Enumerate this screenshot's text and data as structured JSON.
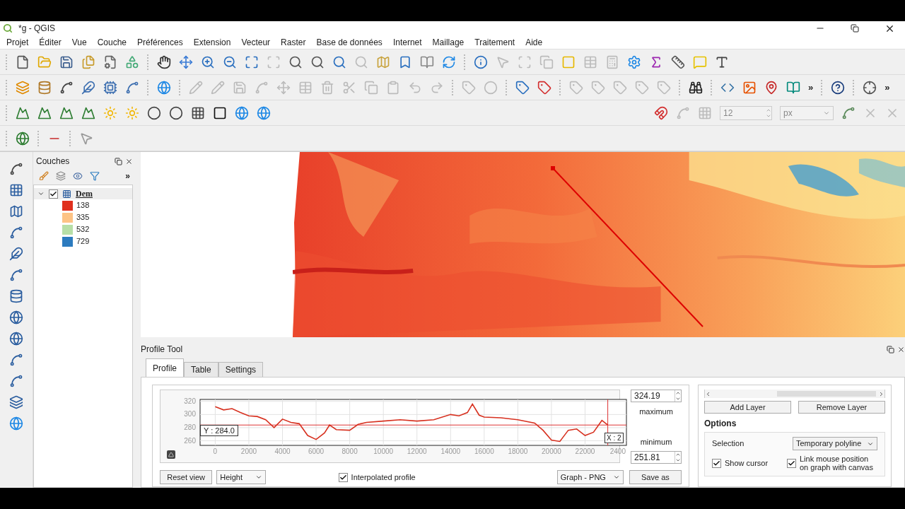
{
  "window": {
    "title": "*g - QGIS"
  },
  "menu": [
    "Projet",
    "Éditer",
    "Vue",
    "Couche",
    "Préférences",
    "Extension",
    "Vecteur",
    "Raster",
    "Base de données",
    "Internet",
    "Maillage",
    "Traitement",
    "Aide"
  ],
  "toolbar": {
    "overflow": [
      "»",
      "»"
    ],
    "snapping_tolerance": "12",
    "snapping_unit": "px"
  },
  "layers_panel": {
    "title": "Couches",
    "overflow": "»",
    "layers": [
      {
        "name": "Dem",
        "checked": true,
        "expanded": true,
        "children": [
          {
            "label": "138",
            "color": "#e0301e"
          },
          {
            "label": "335",
            "color": "#fdc385"
          },
          {
            "label": "532",
            "color": "#b7dfa7"
          },
          {
            "label": "729",
            "color": "#2c7bbf"
          }
        ]
      }
    ]
  },
  "profile_tool": {
    "title": "Profile Tool",
    "tabs": [
      {
        "label": "Profile",
        "selected": true
      },
      {
        "label": "Table",
        "selected": false
      },
      {
        "label": "Settings",
        "selected": false
      }
    ],
    "chart_data": {
      "type": "line",
      "x": [
        0,
        500,
        1000,
        1500,
        2000,
        2500,
        3000,
        3500,
        4000,
        4500,
        5000,
        5500,
        6000,
        6500,
        6800,
        7200,
        8000,
        8500,
        9000,
        10000,
        11000,
        12000,
        13000,
        14000,
        14500,
        15000,
        15300,
        15700,
        16000,
        17000,
        18000,
        19000,
        19500,
        20000,
        20500,
        21000,
        21500,
        22000,
        22500,
        23000,
        23350
      ],
      "series": [
        {
          "color": "#d7301f",
          "values": [
            312,
            307,
            309,
            303,
            298,
            297,
            292,
            280,
            293,
            288,
            286,
            268,
            262,
            272,
            284,
            277,
            276,
            285,
            288,
            290,
            292,
            290,
            292,
            300,
            298,
            303,
            316,
            299,
            296,
            295,
            292,
            287,
            276,
            261,
            259,
            276,
            278,
            268,
            273,
            291,
            284
          ]
        }
      ],
      "xlim": [
        -900,
        24460
      ],
      "ylim": [
        253,
        323
      ],
      "xticks": [
        0,
        2000,
        4000,
        6000,
        8000,
        10000,
        12000,
        14000,
        16000,
        18000,
        20000,
        22000
      ],
      "yticks": [
        260,
        280,
        300,
        320
      ],
      "grid": true,
      "ref_lines": [
        {
          "axis": "y",
          "value": 284
        },
        {
          "axis": "x",
          "value": 23350
        }
      ]
    },
    "x_tick_cut": "2400",
    "cursor_y": "Y : 284.0",
    "cursor_x": "X : 2",
    "maximum": {
      "value": "324.19",
      "label": "maximum"
    },
    "minimum": {
      "value": "251.81",
      "label": "minimum"
    },
    "reset_button": "Reset view",
    "plot_select": "Height",
    "interpolated": {
      "label": "Interpolated profile",
      "checked": true
    },
    "export_select": "Graph - PNG",
    "save_button": "Save as",
    "add_layer": "Add Layer",
    "remove_layer": "Remove Layer",
    "options": {
      "title": "Options",
      "selection_label": "Selection",
      "selection_value": "Temporary polyline",
      "show_cursor": {
        "label": "Show cursor",
        "checked": true
      },
      "link_mouse": {
        "label": "Link mouse position on graph with canvas",
        "checked": true
      }
    }
  }
}
